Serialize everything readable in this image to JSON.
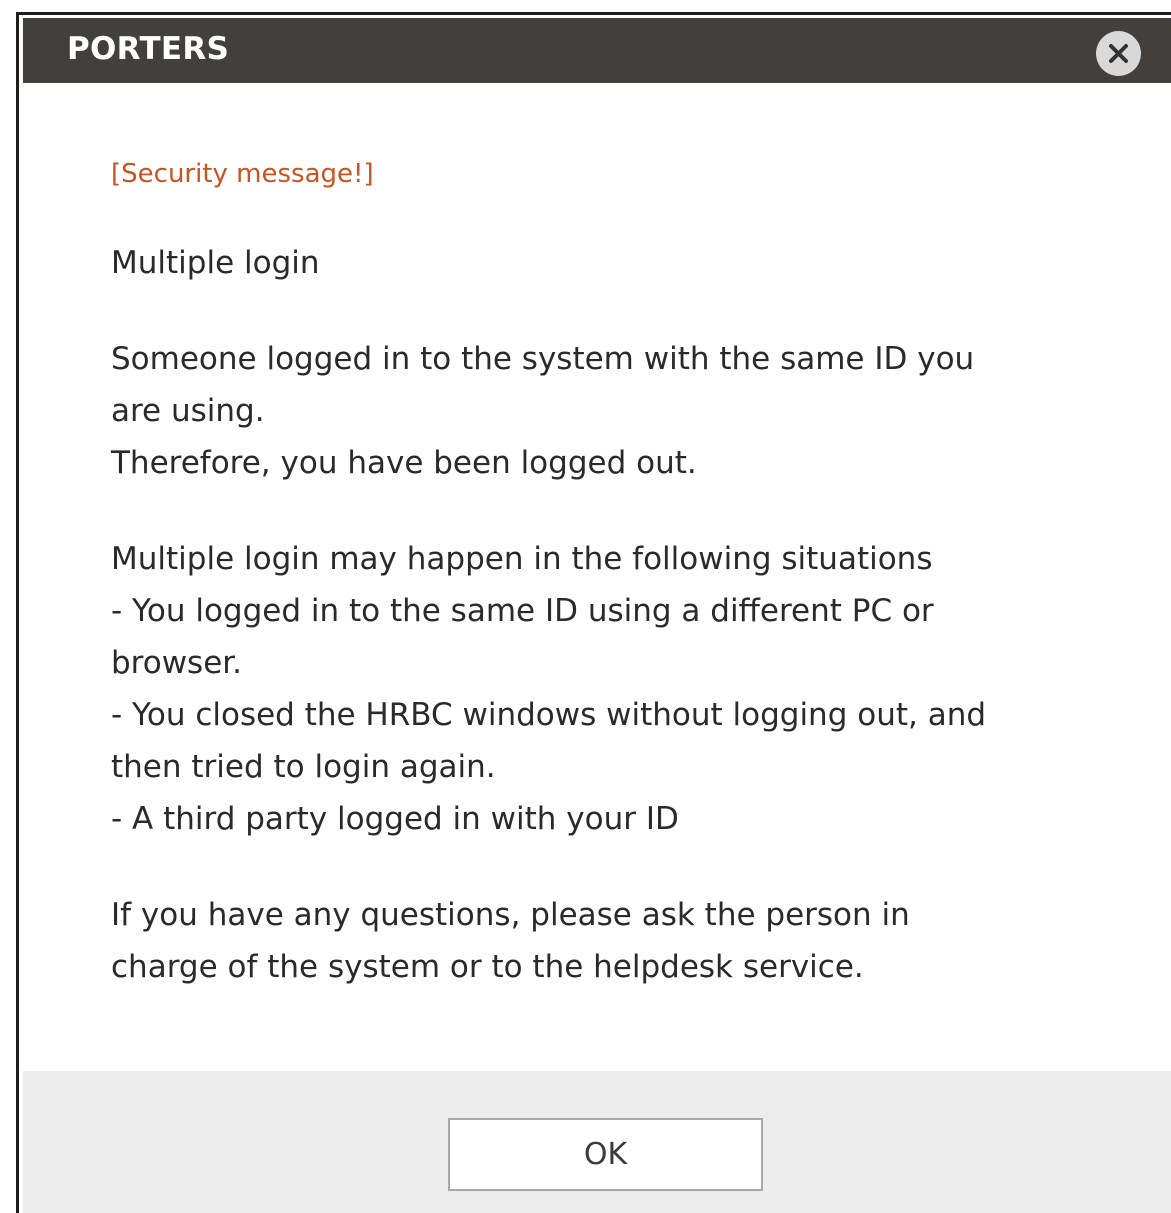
{
  "dialog": {
    "title": "PORTERS",
    "close_icon": "close-icon",
    "security_label": "[Security message!]",
    "heading": "Multiple login",
    "paragraph1": [
      "Someone logged in to the system with the same ID you",
      "are using.",
      "Therefore, you have been logged out."
    ],
    "paragraph2": [
      "Multiple login may happen in the following situations",
      "- You logged in to the same ID using a different PC or",
      "browser.",
      "- You closed the HRBC windows without logging out, and",
      "then tried to login again.",
      "- A third party logged in with your ID"
    ],
    "paragraph3": [
      "If you have any questions, please ask the person in",
      "charge of the system or to the helpdesk service."
    ],
    "ok_label": "OK"
  },
  "colors": {
    "titlebar": "#423f3d",
    "security_text": "#c8541f",
    "footer": "#ececec"
  }
}
